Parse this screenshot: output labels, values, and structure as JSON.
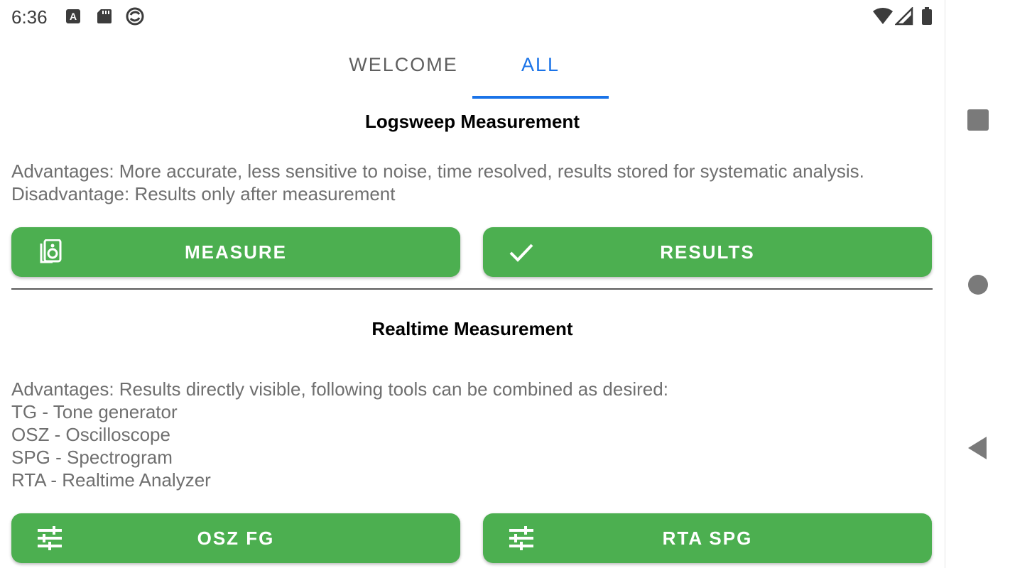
{
  "status_bar": {
    "time": "6:36",
    "icons": [
      "a-notification-icon",
      "sd-card-icon",
      "sync-icon",
      "wifi-icon",
      "signal-icon",
      "battery-icon"
    ]
  },
  "tabs": [
    {
      "label": "WELCOME",
      "selected": false
    },
    {
      "label": "ALL",
      "selected": true
    }
  ],
  "colors": {
    "accent": "#1a73e8",
    "button": "#4caf50",
    "text_secondary": "#6f6f6f"
  },
  "logsweep": {
    "title": "Logsweep Measurement",
    "description": "Advantages: More accurate, less sensitive to noise, time resolved, results stored for systematic analysis.\nDisadvantage: Results only after measurement",
    "buttons": [
      {
        "label": "MEASURE",
        "icon": "speaker-icon"
      },
      {
        "label": "RESULTS",
        "icon": "check-icon"
      }
    ]
  },
  "realtime": {
    "title": "Realtime Measurement",
    "description": "Advantages: Results directly visible, following tools can be combined as desired:\nTG - Tone generator\nOSZ - Oscilloscope\nSPG - Spectrogram\nRTA - Realtime Analyzer",
    "buttons": [
      {
        "label": "OSZ FG",
        "icon": "tune-icon"
      },
      {
        "label": "RTA SPG",
        "icon": "tune-icon"
      }
    ]
  },
  "nav_bar": {
    "icons": [
      "recents-square-icon",
      "home-circle-icon",
      "back-triangle-icon"
    ]
  }
}
